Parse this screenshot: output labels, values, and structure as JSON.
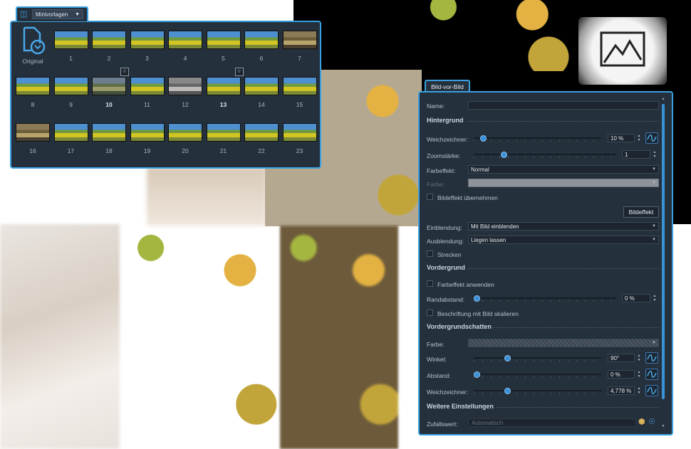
{
  "templates": {
    "dropdown_value": "Minivorlagen",
    "original_label": "Original",
    "items": [
      {
        "label": "1",
        "bold": false,
        "star": false
      },
      {
        "label": "2",
        "bold": false,
        "star": false
      },
      {
        "label": "3",
        "bold": false,
        "star": false
      },
      {
        "label": "4",
        "bold": false,
        "star": false
      },
      {
        "label": "5",
        "bold": false,
        "star": false
      },
      {
        "label": "6",
        "bold": false,
        "star": false
      },
      {
        "label": "7",
        "bold": false,
        "star": false
      },
      {
        "label": "8",
        "bold": false,
        "star": false
      },
      {
        "label": "9",
        "bold": false,
        "star": false
      },
      {
        "label": "10",
        "bold": true,
        "star": true
      },
      {
        "label": "11",
        "bold": false,
        "star": false
      },
      {
        "label": "12",
        "bold": false,
        "star": false
      },
      {
        "label": "13",
        "bold": true,
        "star": true
      },
      {
        "label": "14",
        "bold": false,
        "star": false
      },
      {
        "label": "15",
        "bold": false,
        "star": false
      },
      {
        "label": "16",
        "bold": false,
        "star": false
      },
      {
        "label": "17",
        "bold": false,
        "star": false
      },
      {
        "label": "18",
        "bold": false,
        "star": false
      },
      {
        "label": "19",
        "bold": false,
        "star": false
      },
      {
        "label": "20",
        "bold": false,
        "star": false
      },
      {
        "label": "21",
        "bold": false,
        "star": false
      },
      {
        "label": "22",
        "bold": false,
        "star": false
      },
      {
        "label": "23",
        "bold": false,
        "star": false
      }
    ]
  },
  "pip": {
    "tab_label": "Bild-vor-Bild",
    "name_label": "Name:",
    "name_value": "",
    "sections": {
      "hintergrund": "Hintergrund",
      "vordergrund": "Vordergrund",
      "vordergrundschatten": "Vordergrundschatten",
      "weitere": "Weitere Einstellungen"
    },
    "bg": {
      "blur_label": "Weichzeichner:",
      "blur_value": "10 %",
      "blur_level": 0.05,
      "zoom_label": "Zoomstärke:",
      "zoom_value": "1",
      "zoom_level": 0.2,
      "color_effect_label": "Farbeffekt:",
      "color_effect_value": "Normal",
      "color_label": "Farbe:",
      "adopt_effect_label": "Bildeffekt übernehmen",
      "image_effect_button": "Bildeffekt",
      "fade_in_label": "Einblendung:",
      "fade_in_value": "Mit Bild einblenden",
      "fade_out_label": "Ausblendung:",
      "fade_out_value": "Liegen lassen",
      "stretch_label": "Strecken"
    },
    "fg": {
      "apply_effect_label": "Farbeffekt anwenden",
      "border_label": "Randabstand:",
      "border_value": "0 %",
      "border_level": 0,
      "scale_label": "Beschriftung mit Bild skalieren"
    },
    "shadow": {
      "color_label": "Farbe:",
      "angle_label": "Winkel:",
      "angle_value": "90°",
      "angle_level": 0.25,
      "distance_label": "Abstand:",
      "distance_value": "0 %",
      "distance_level": 0,
      "blur_label": "Weichzeichner:",
      "blur_value": "4,778 %",
      "blur_level": 0.25
    },
    "more": {
      "random_label": "Zufallswert:",
      "random_placeholder": "Automatisch"
    }
  }
}
